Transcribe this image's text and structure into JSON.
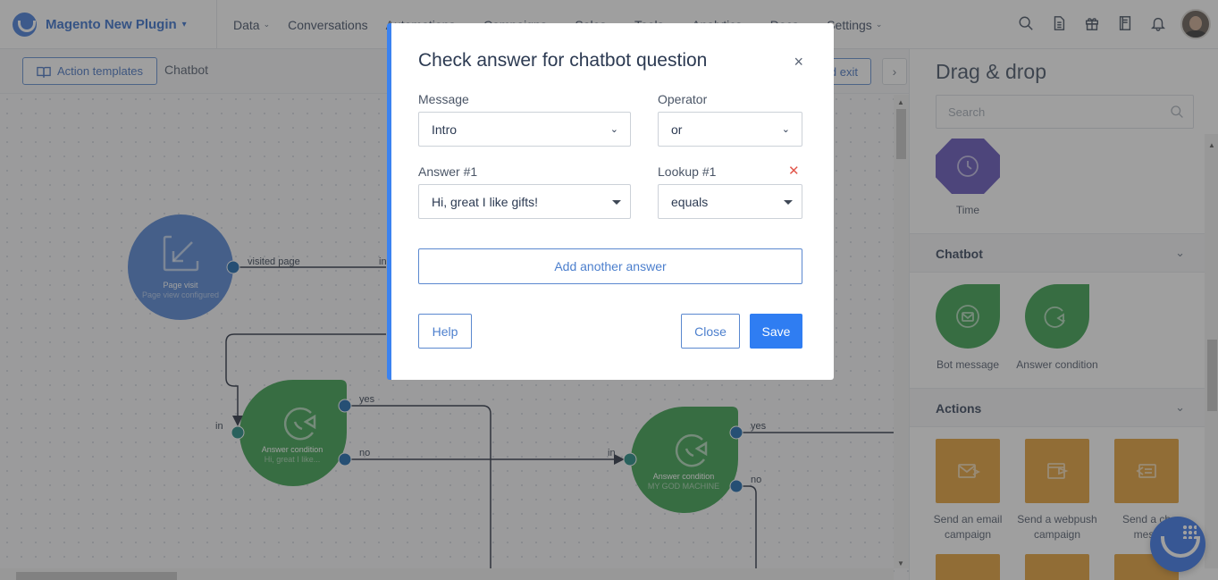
{
  "app": {
    "brand": "Magento New Plugin",
    "nav": [
      "Data",
      "Conversations",
      "Automations",
      "Campaigns",
      "Sales",
      "Tools",
      "Analytics",
      "Docs",
      "Settings"
    ],
    "nav_has_caret": [
      true,
      false,
      true,
      true,
      true,
      true,
      true,
      true,
      true
    ],
    "header_icons": [
      "search-icon",
      "document-icon",
      "gift-icon",
      "book-icon",
      "bell-icon"
    ]
  },
  "toolbar": {
    "templates_button": "Action templates",
    "breadcrumb": "Chatbot",
    "exit_button": "d exit",
    "collapse_glyph": "›"
  },
  "flow": {
    "nodes": [
      {
        "title": "Page visit",
        "subtitle": "Page view configured",
        "color": "#4a7fd3"
      },
      {
        "title": "Answer condition",
        "subtitle": "Hi, great I like...",
        "color": "#2e9a44"
      },
      {
        "title": "Answer condition",
        "subtitle": "MY GOD MACHINE",
        "color": "#2e9a44"
      }
    ],
    "port_labels": {
      "visited_page": "visited page",
      "in": "in",
      "yes": "yes",
      "no": "no"
    }
  },
  "panel": {
    "title": "Drag & drop",
    "search_placeholder": "Search",
    "time_label": "Time",
    "sections": [
      {
        "label": "Chatbot",
        "items": [
          "Bot message",
          "Answer condition"
        ]
      },
      {
        "label": "Actions",
        "items": [
          "Send an email campaign",
          "Send a webpush campaign",
          "Send a chat message"
        ]
      }
    ],
    "action_labels": {
      "email_line1": "Send an email",
      "email_line2": "campaign",
      "webpush_line1": "Send a webpush",
      "webpush_line2": "campaign",
      "chat_line1": "Send a ch",
      "chat_line2": "mess"
    },
    "colors": {
      "time": "#5b4bb7",
      "chatbot": "#2e9a44",
      "actions": "#e39a2c"
    }
  },
  "modal": {
    "title": "Check answer for chatbot question",
    "close_glyph": "×",
    "message_label": "Message",
    "message_value": "Intro",
    "operator_label": "Operator",
    "operator_value": "or",
    "answer_label": "Answer #1",
    "answer_value": "Hi, great I like gifts!",
    "lookup_label": "Lookup #1",
    "lookup_value": "equals",
    "remove_glyph": "✕",
    "add_answer": "Add another answer",
    "help": "Help",
    "close": "Close",
    "save": "Save"
  }
}
